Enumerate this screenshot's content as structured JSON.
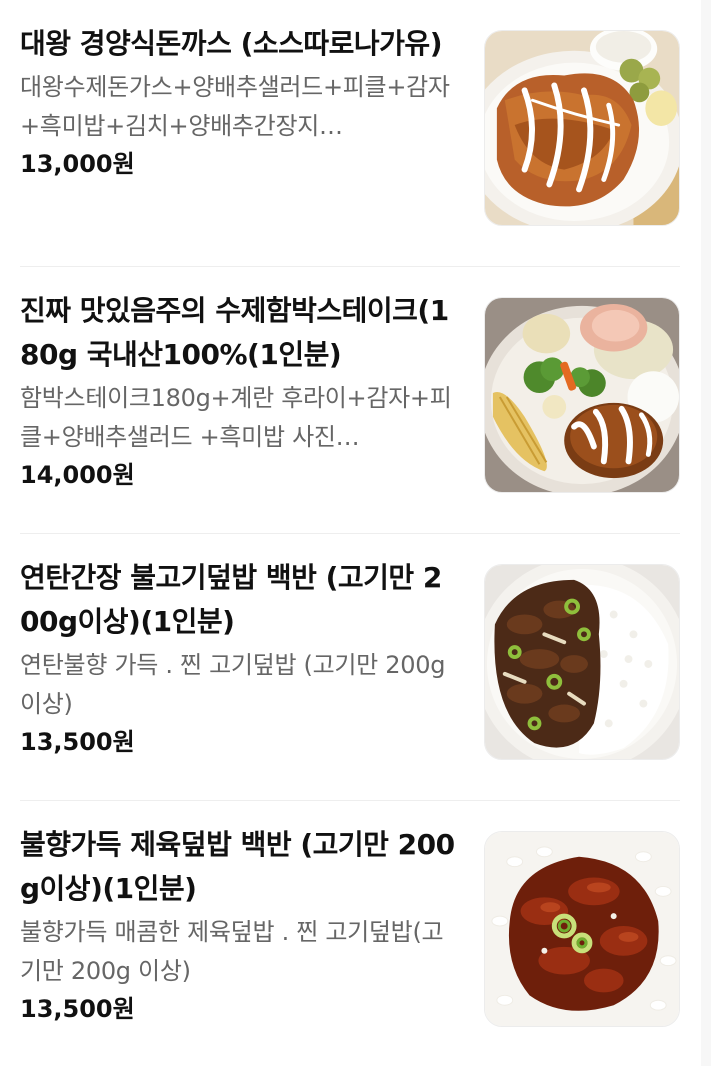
{
  "menu": {
    "items": [
      {
        "name": "대왕 경양식돈까스 (소스따로나가유)",
        "description": "대왕수제돈가스+양배추샐러드+피클+감자+흑미밥+김치+양배추간장지…",
        "price": "13,000원",
        "image_icon": "tonkatsu-photo"
      },
      {
        "name": "진짜 맛있음주의 수제함박스테이크(180g 국내산100%(1인분)",
        "description": "함박스테이크180g+계란 후라이+감자+피클+양배추샐러드 +흑미밥 사진…",
        "price": "14,000원",
        "image_icon": "hamburg-steak-photo"
      },
      {
        "name": "연탄간장 불고기덮밥 백반 (고기만 200g이상)(1인분)",
        "description": "연탄불향 가득 . 찐 고기덮밥 (고기만 200g이상)",
        "price": "13,500원",
        "image_icon": "bulgogi-rice-photo"
      },
      {
        "name": "불향가득 제육덮밥 백반 (고기만 200g이상)(1인분)",
        "description": "불향가득 매콤한 제육덮밥 . 찐 고기덮밥(고기만 200g 이상)",
        "price": "13,500원",
        "image_icon": "jeyuk-rice-photo"
      }
    ]
  }
}
